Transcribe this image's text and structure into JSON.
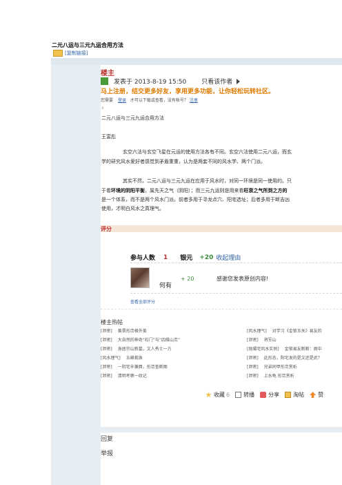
{
  "page": {
    "title": "二元八运与三元九运合用方法",
    "copy_link": "[复制链接]"
  },
  "post": {
    "floor_label": "楼主",
    "posted_at": "发表于  2013-8-19 15:50",
    "author_only": "只看该作者",
    "register_message": "马上注册，结交更多好友，享用更多功能，让你轻松玩转社区。",
    "login_prefix": "您需要",
    "login_link": "登录",
    "login_middle": "才可以下载或查看，没有帐号？",
    "register_link": "注册",
    "tiny_mark": "x",
    "content": {
      "heading": "二元八运与三元九运合用方法",
      "author": "王富彪",
      "p1_l1": "玄空六法与玄空飞星在元运的使用方法各有不同。玄空六法使用二元八运，而玄",
      "p1_l2": "学的研究风水爱好者感觉到矛盾重重，认为是两套不同的风水学、两个门派。",
      "p2_l1": "其实不然，二元八运与三元九运在应用于风水时，对同一环境是同一使用的。只",
      "p2_l2_a": "于看",
      "p2_l2_b": "环境的阴阳平衡",
      "p2_l2_c": "，属先天之气（阴阳）；而三元九运则是用来看",
      "p2_l2_d": "旺衰之气所到之方的",
      "p2_l3": "是一个体系，而不是两个风水门派。前者多用于寻龙点穴、阳宅选址；后者多用于断吉凶",
      "p2_l4": "使用，才明白风水之真理气。"
    }
  },
  "rating": {
    "label": "评分",
    "participants_label": "参与人数",
    "participants_count": "1",
    "currency_label": "银元",
    "currency_total": "+20",
    "collapse_reason": "收起理由",
    "rater_name": "何有",
    "rater_score": "+ 20",
    "rater_reason": "感谢您发表原创内容!",
    "view_all": "查看全部评分"
  },
  "hot_posts": {
    "title": "楼主热帖",
    "left": [
      {
        "tag": "[泄密]",
        "text": "黄晋形峦格外美"
      },
      {
        "tag": "[泄密]",
        "text": "大自然的神奇“石门”与“四维山峦”"
      },
      {
        "tag": "[泄密]",
        "text": "身居宗山新墓，文人秀士一方"
      },
      {
        "tag": "[风水理气]",
        "text": "五峰栽珠"
      },
      {
        "tag": "[泄密]",
        "text": "一阴宅辛兼酉，形峦查断图"
      },
      {
        "tag": "[泄密]",
        "text": "清明考察一纹记"
      }
    ],
    "right": [
      {
        "tag": "[风水理气]",
        "text": "对学习《金锁玉关》易友的"
      },
      {
        "tag": "[泄密]",
        "text": "将军山"
      },
      {
        "tag": "[陰陽宅风水实例]",
        "text": "金锁易友断断：阁中"
      },
      {
        "tag": "[泄密]",
        "text": "此形态，阳宅发的是文还是武？"
      },
      {
        "tag": "[泄密]",
        "text": "兄弟同甲形峦赏析"
      },
      {
        "tag": "[泄密]",
        "text": "上水龟 形峦赏析"
      }
    ]
  },
  "actions": {
    "favorite": "收藏",
    "favorite_count": "6",
    "repost": "转播",
    "share": "分享",
    "vote": "淘帖",
    "like": "赞"
  },
  "footer": {
    "reply": "回复",
    "report": "举报"
  },
  "colors": {
    "floor_red": "#c03030",
    "register_orange": "#e07b00",
    "link_blue": "#3366aa",
    "sidebar_bg": "#e6eef4"
  }
}
